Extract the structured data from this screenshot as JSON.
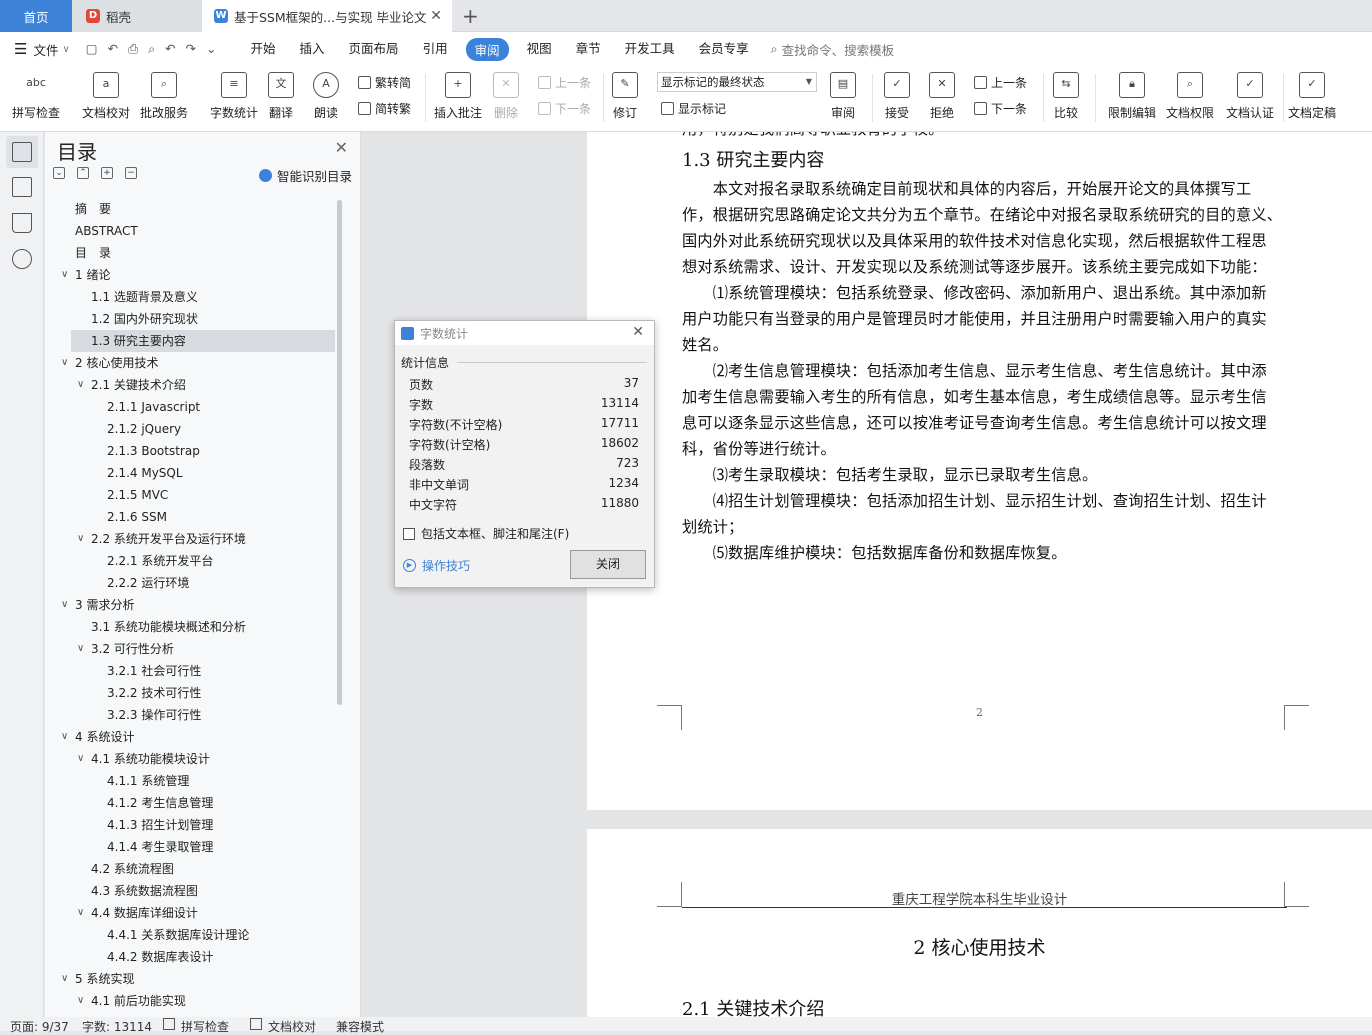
{
  "tabs": {
    "home": "首页",
    "daoke": "稻壳",
    "doc": "基于SSM框架的...与实现 毕业论文",
    "add": "+"
  },
  "menu": {
    "file": "文件",
    "items": [
      "开始",
      "插入",
      "页面布局",
      "引用",
      "审阅",
      "视图",
      "章节",
      "开发工具",
      "会员专享"
    ],
    "active_index": 4,
    "search": "查找命令、搜索模板"
  },
  "ribbon": {
    "spellcheck": "拼写检查",
    "doc_proof": "文档校对",
    "revise_service": "批改服务",
    "word_count": "字数统计",
    "translate": "翻译",
    "read_aloud": "朗读",
    "trad": "繁转简",
    "simp": "简转繁",
    "insert_comment": "插入批注",
    "delete": "删除",
    "prev_comment": "上一条",
    "next_comment": "下一条",
    "revise": "修订",
    "markup_select": "显示标记的最终状态",
    "show_markup": "显示标记",
    "review": "审阅",
    "accept": "接受",
    "reject": "拒绝",
    "prev": "上一条",
    "next": "下一条",
    "compare": "比较",
    "restrict": "限制编辑",
    "doc_rights": "文档权限",
    "doc_auth": "文档认证",
    "doc_final": "文档定稿"
  },
  "toc": {
    "title": "目录",
    "smart": "智能识别目录",
    "items": [
      {
        "t": "摘　要",
        "l": 0,
        "c": ""
      },
      {
        "t": "ABSTRACT",
        "l": 0,
        "c": ""
      },
      {
        "t": "目　录",
        "l": 0,
        "c": ""
      },
      {
        "t": "1  绪论",
        "l": 0,
        "c": "v"
      },
      {
        "t": "1.1  选题背景及意义",
        "l": 1,
        "c": ""
      },
      {
        "t": "1.2  国内外研究现状",
        "l": 1,
        "c": ""
      },
      {
        "t": "1.3  研究主要内容",
        "l": 1,
        "c": "",
        "sel": true
      },
      {
        "t": "2  核心使用技术",
        "l": 0,
        "c": "v"
      },
      {
        "t": "2.1  关键技术介绍",
        "l": 1,
        "c": "v"
      },
      {
        "t": "2.1.1 Javascript",
        "l": 2,
        "c": ""
      },
      {
        "t": "2.1.2 jQuery",
        "l": 2,
        "c": ""
      },
      {
        "t": "2.1.3 Bootstrap",
        "l": 2,
        "c": ""
      },
      {
        "t": "2.1.4 MySQL",
        "l": 2,
        "c": ""
      },
      {
        "t": "2.1.5 MVC",
        "l": 2,
        "c": ""
      },
      {
        "t": "2.1.6 SSM",
        "l": 2,
        "c": ""
      },
      {
        "t": "2.2  系统开发平台及运行环境",
        "l": 1,
        "c": "v"
      },
      {
        "t": "2.2.1  系统开发平台",
        "l": 2,
        "c": ""
      },
      {
        "t": "2.2.2  运行环境",
        "l": 2,
        "c": ""
      },
      {
        "t": "3  需求分析",
        "l": 0,
        "c": "v"
      },
      {
        "t": "3.1  系统功能模块概述和分析",
        "l": 1,
        "c": ""
      },
      {
        "t": "3.2  可行性分析",
        "l": 1,
        "c": "v"
      },
      {
        "t": "3.2.1  社会可行性",
        "l": 2,
        "c": ""
      },
      {
        "t": "3.2.2  技术可行性",
        "l": 2,
        "c": ""
      },
      {
        "t": "3.2.3  操作可行性",
        "l": 2,
        "c": ""
      },
      {
        "t": "4  系统设计",
        "l": 0,
        "c": "v"
      },
      {
        "t": "4.1  系统功能模块设计",
        "l": 1,
        "c": "v"
      },
      {
        "t": "4.1.1  系统管理",
        "l": 2,
        "c": ""
      },
      {
        "t": "4.1.2  考生信息管理",
        "l": 2,
        "c": ""
      },
      {
        "t": "4.1.3  招生计划管理",
        "l": 2,
        "c": ""
      },
      {
        "t": "4.1.4  考生录取管理",
        "l": 2,
        "c": ""
      },
      {
        "t": "4.2  系统流程图",
        "l": 1,
        "c": ""
      },
      {
        "t": "4.3  系统数据流程图",
        "l": 1,
        "c": ""
      },
      {
        "t": "4.4  数据库详细设计",
        "l": 1,
        "c": "v"
      },
      {
        "t": "4.4.1  关系数据库设计理论",
        "l": 2,
        "c": ""
      },
      {
        "t": "4.4.2  数据库表设计",
        "l": 2,
        "c": ""
      },
      {
        "t": "5  系统实现",
        "l": 0,
        "c": "v"
      },
      {
        "t": "4.1  前后功能实现",
        "l": 1,
        "c": "v"
      }
    ]
  },
  "doc": {
    "top_cut": "用，特别是我们高等职业教育的学校。",
    "heading": "1.3  研究主要内容",
    "lines": [
      "　　本文对报名录取系统确定目前现状和具体的内容后，开始展开论文的具体撰写工",
      "作，根据研究思路确定论文共分为五个章节。在绪论中对报名录取系统研究的目的意义、",
      "国内外对此系统研究现状以及具体采用的软件技术对信息化实现，然后根据软件工程思",
      "想对系统需求、设计、开发实现以及系统测试等逐步展开。该系统主要完成如下功能：",
      "　　⑴系统管理模块：包括系统登录、修改密码、添加新用户、退出系统。其中添加新",
      "用户功能只有当登录的用户是管理员时才能使用，并且注册用户时需要输入用户的真实",
      "姓名。",
      "　　⑵考生信息管理模块：包括添加考生信息、显示考生信息、考生信息统计。其中添",
      "加考生信息需要输入考生的所有信息，如考生基本信息，考生成绩信息等。显示考生信",
      "息可以逐条显示这些信息，还可以按准考证号查询考生信息。考生信息统计可以按文理",
      "科，省份等进行统计。",
      "　　⑶考生录取模块：包括考生录取，显示已录取考生信息。",
      "　　⑷招生计划管理模块：包括添加招生计划、显示招生计划、查询招生计划、招生计",
      "划统计；",
      "　　⑸数据库维护模块：包括数据库备份和数据库恢复。"
    ],
    "page_num": "2",
    "header2": "重庆工程学院本科生毕业设计",
    "chapter2": "2  核心使用技术",
    "sub_cut": "2.1  关键技术介绍"
  },
  "dialog": {
    "title": "字数统计",
    "section": "统计信息",
    "rows": [
      {
        "k": "页数",
        "v": "37"
      },
      {
        "k": "字数",
        "v": "13114"
      },
      {
        "k": "字符数(不计空格)",
        "v": "17711"
      },
      {
        "k": "字符数(计空格)",
        "v": "18602"
      },
      {
        "k": "段落数",
        "v": "723"
      },
      {
        "k": "非中文单词",
        "v": "1234"
      },
      {
        "k": "中文字符",
        "v": "11880"
      }
    ],
    "include": "包括文本框、脚注和尾注(F)",
    "tips": "操作技巧",
    "close": "关闭"
  },
  "status": {
    "page": "页面: 9/37",
    "words": "字数: 13114",
    "spell": "拼写检查",
    "proof": "文档校对",
    "compat": "兼容模式"
  },
  "colors": {
    "accent": "#3b82d8",
    "daoke": "#e0463a"
  }
}
